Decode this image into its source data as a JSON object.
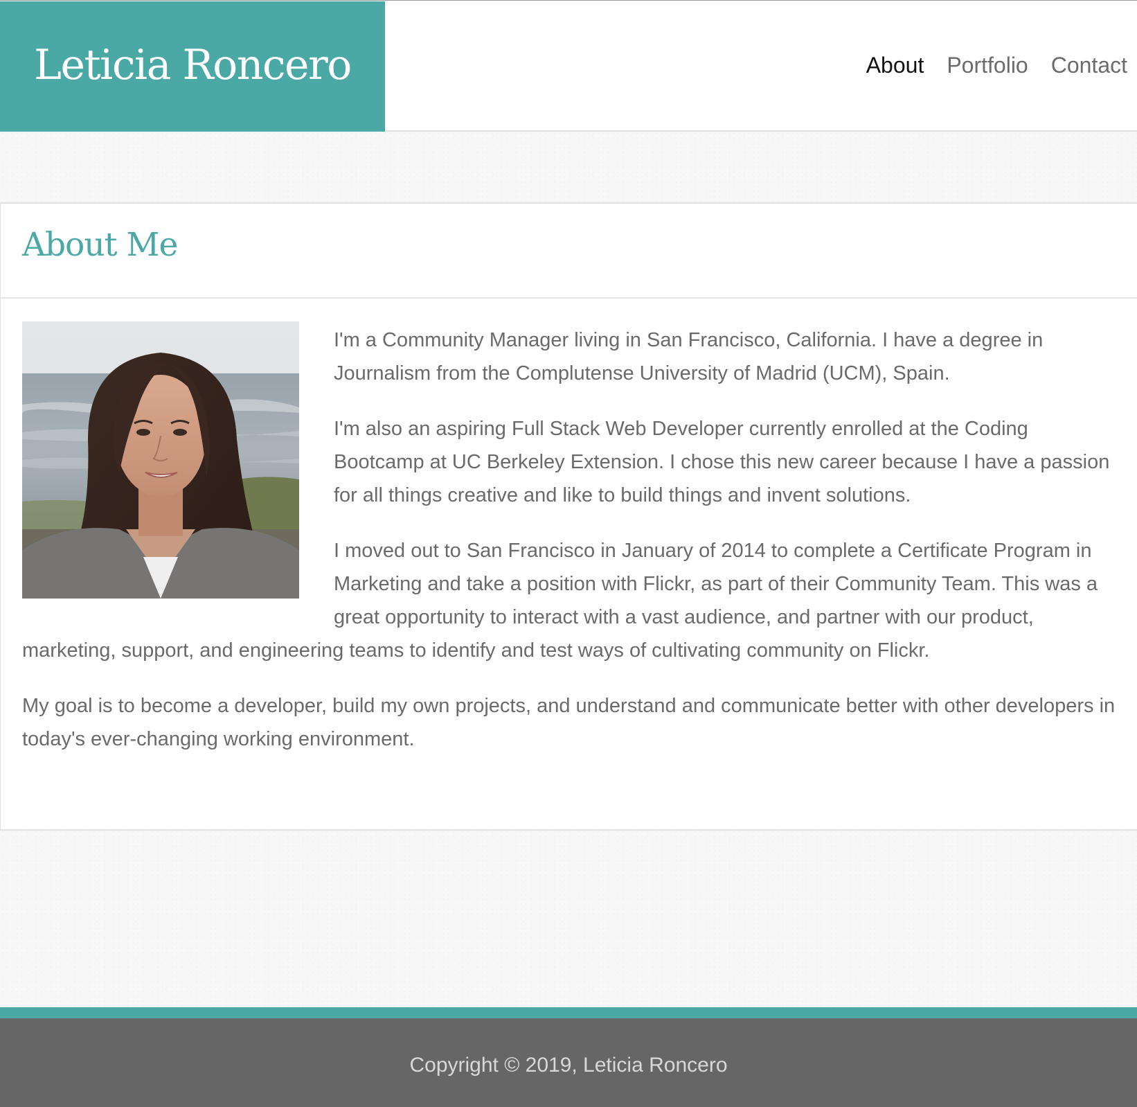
{
  "header": {
    "brand": "Leticia Roncero",
    "nav": [
      {
        "label": "About",
        "active": true
      },
      {
        "label": "Portfolio",
        "active": false
      },
      {
        "label": "Contact",
        "active": false
      }
    ]
  },
  "about": {
    "title": "About Me",
    "photo_alt": "Leticia Roncero",
    "paragraphs": [
      "I'm a Community Manager living in San Francisco, California. I have a degree in Journalism from the Complutense University of Madrid (UCM), Spain.",
      "I'm also an aspiring Full Stack Web Developer currently enrolled at the Coding Bootcamp at UC Berkeley Extension. I chose this new career because I have a passion for all things creative and like to build things and invent solutions.",
      "I moved out to San Francisco in January of 2014 to complete a Certificate Program in Marketing and take a position with Flickr, as part of their Community Team. This was a great opportunity to interact with a vast audience, and partner with our product, marketing, support, and engineering teams to identify and test ways of cultivating community on Flickr.",
      "My goal is to become a developer, build my own projects, and understand and communicate better with other developers in today's ever-changing working environment."
    ]
  },
  "footer": {
    "copyright": "Copyright © 2019, Leticia Roncero"
  },
  "colors": {
    "accent": "#4aa8a5",
    "footer_bg": "#666666",
    "body_text": "#6a6a6a"
  }
}
